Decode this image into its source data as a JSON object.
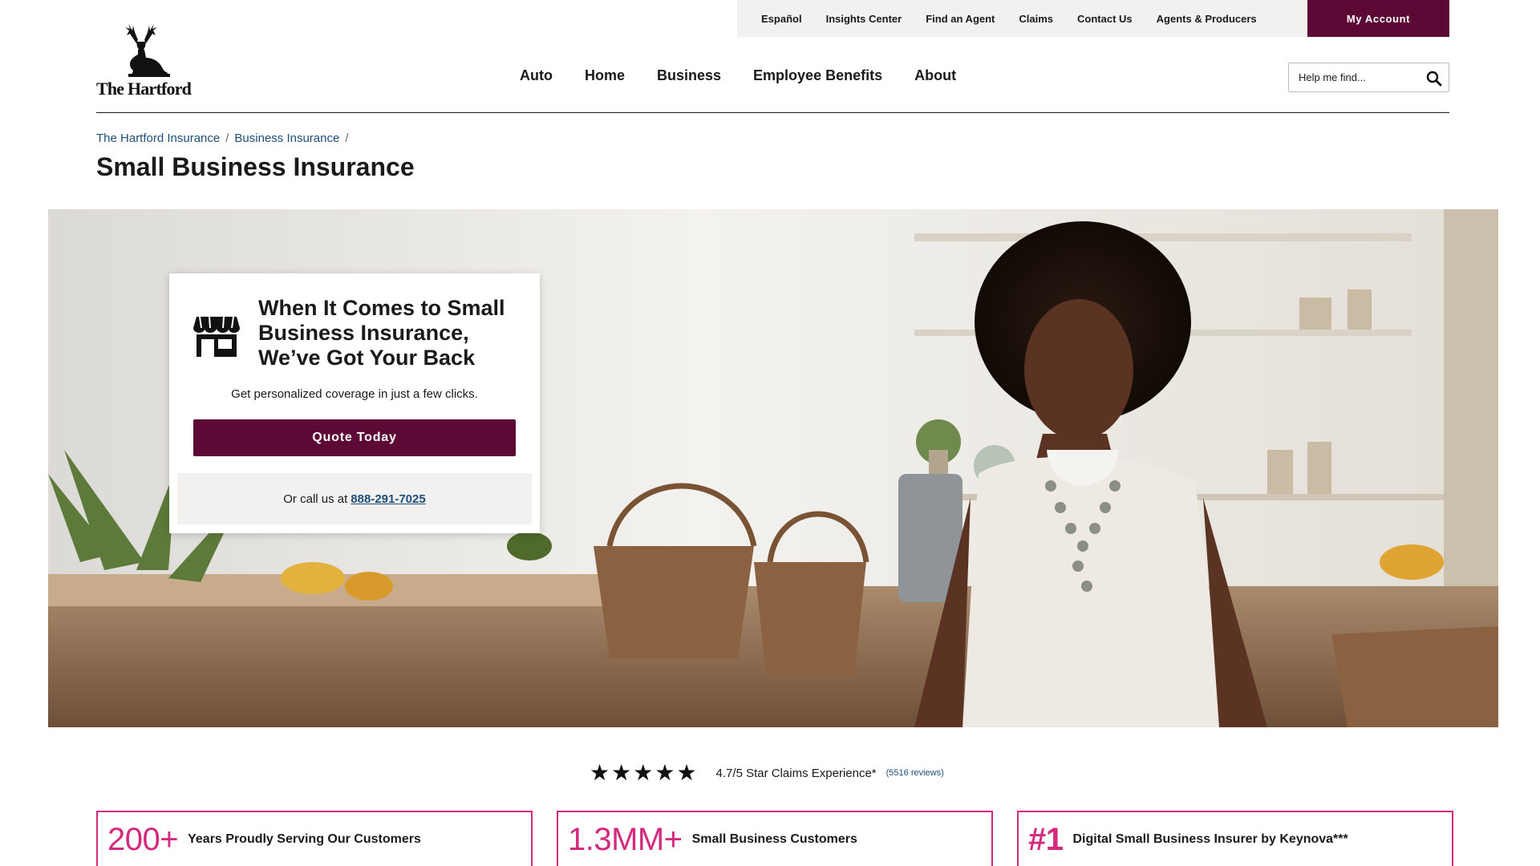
{
  "utility_nav": {
    "items": [
      "Español",
      "Insights Center",
      "Find an Agent",
      "Claims",
      "Contact Us",
      "Agents & Producers"
    ],
    "account_button": "My Account"
  },
  "logo": {
    "text": "The Hartford",
    "icon": "stag-icon"
  },
  "main_nav": {
    "items": [
      "Auto",
      "Home",
      "Business",
      "Employee Benefits",
      "About"
    ]
  },
  "search": {
    "placeholder": "Help me find...",
    "icon": "search-icon"
  },
  "breadcrumb": {
    "items": [
      "The Hartford Insurance",
      "Business Insurance"
    ],
    "separator": "/"
  },
  "page_title": "Small Business Insurance",
  "quote_card": {
    "icon": "storefront-icon",
    "heading": "When It Comes to Small Business Insurance, We’ve Got Your Back",
    "subheading": "Get personalized coverage in just a few clicks.",
    "button_label": "Quote Today",
    "call_prefix": "Or call us at",
    "phone": "888-291-7025"
  },
  "rating": {
    "stars": 4.7,
    "text": "4.7/5 Star Claims Experience*",
    "reviews_link": "(5516 reviews)"
  },
  "stats": [
    {
      "value": "200+",
      "label": "Years Proudly Serving Our Customers"
    },
    {
      "value": "1.3MM+",
      "label": "Small Business Customers"
    },
    {
      "value": "#1",
      "label": "Digital Small Business Insurer by Keynova***"
    }
  ],
  "colors": {
    "brand_maroon": "#5c0a35",
    "accent_pink": "#d42a7e",
    "link_blue": "#1f4e79",
    "utility_bg": "#f2f1ef"
  }
}
